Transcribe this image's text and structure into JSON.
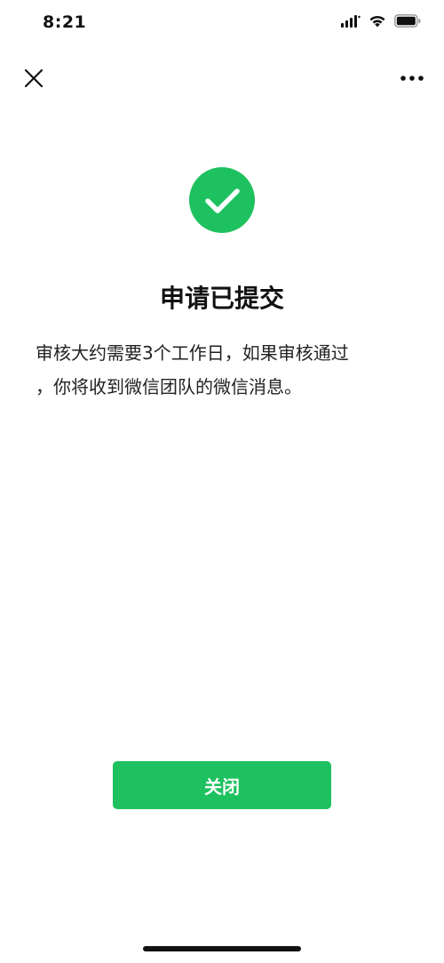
{
  "status_bar": {
    "time": "8:21",
    "icons": [
      "signal-icon",
      "wifi-icon",
      "battery-icon"
    ]
  },
  "nav": {
    "close_icon": "close-icon",
    "more_icon": "more-icon"
  },
  "result": {
    "icon": "check-circle-icon",
    "icon_color": "#1ec15f",
    "title": "申请已提交",
    "description_line1": "审核大约需要3个工作日，如果审核通过",
    "description_line2": "，你将收到微信团队的微信消息。"
  },
  "actions": {
    "close_label": "关闭",
    "button_color": "#1ec15f"
  }
}
